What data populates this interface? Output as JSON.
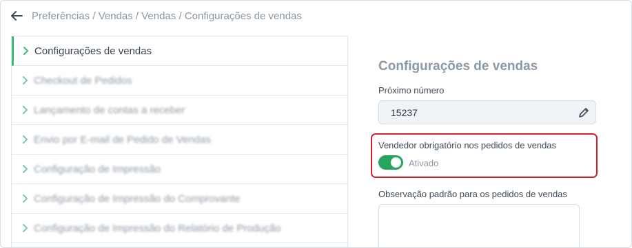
{
  "breadcrumb": "Preferências / Vendas / Vendas / Configurações de vendas",
  "menu": {
    "items": [
      {
        "label": "Configurações de vendas",
        "active": true
      },
      {
        "label": "Checkout de Pedidos",
        "active": false
      },
      {
        "label": "Lançamento de contas a receber",
        "active": false
      },
      {
        "label": "Envio por E-mail de Pedido de Vendas",
        "active": false
      },
      {
        "label": "Configuração de Impressão",
        "active": false
      },
      {
        "label": "Configuração de Impressão do Comprovante",
        "active": false
      },
      {
        "label": "Configuração de Impressão do Relatório de Produção",
        "active": false
      }
    ]
  },
  "panel": {
    "title": "Configurações de vendas",
    "next_number_label": "Próximo número",
    "next_number_value": "15237",
    "seller_required_label": "Vendedor obrigatório nos pedidos de vendas",
    "seller_required_state": "Ativado",
    "seller_required_on": true,
    "default_note_label": "Observação padrão para os pedidos de vendas",
    "default_note_value": ""
  },
  "icons": {
    "back": "arrow-left-icon",
    "chevron": "chevron-right-icon",
    "edit": "pencil-icon"
  },
  "colors": {
    "accent_green": "#28a55d",
    "highlight_red": "#d0202a",
    "muted_text": "#8c98a4"
  }
}
